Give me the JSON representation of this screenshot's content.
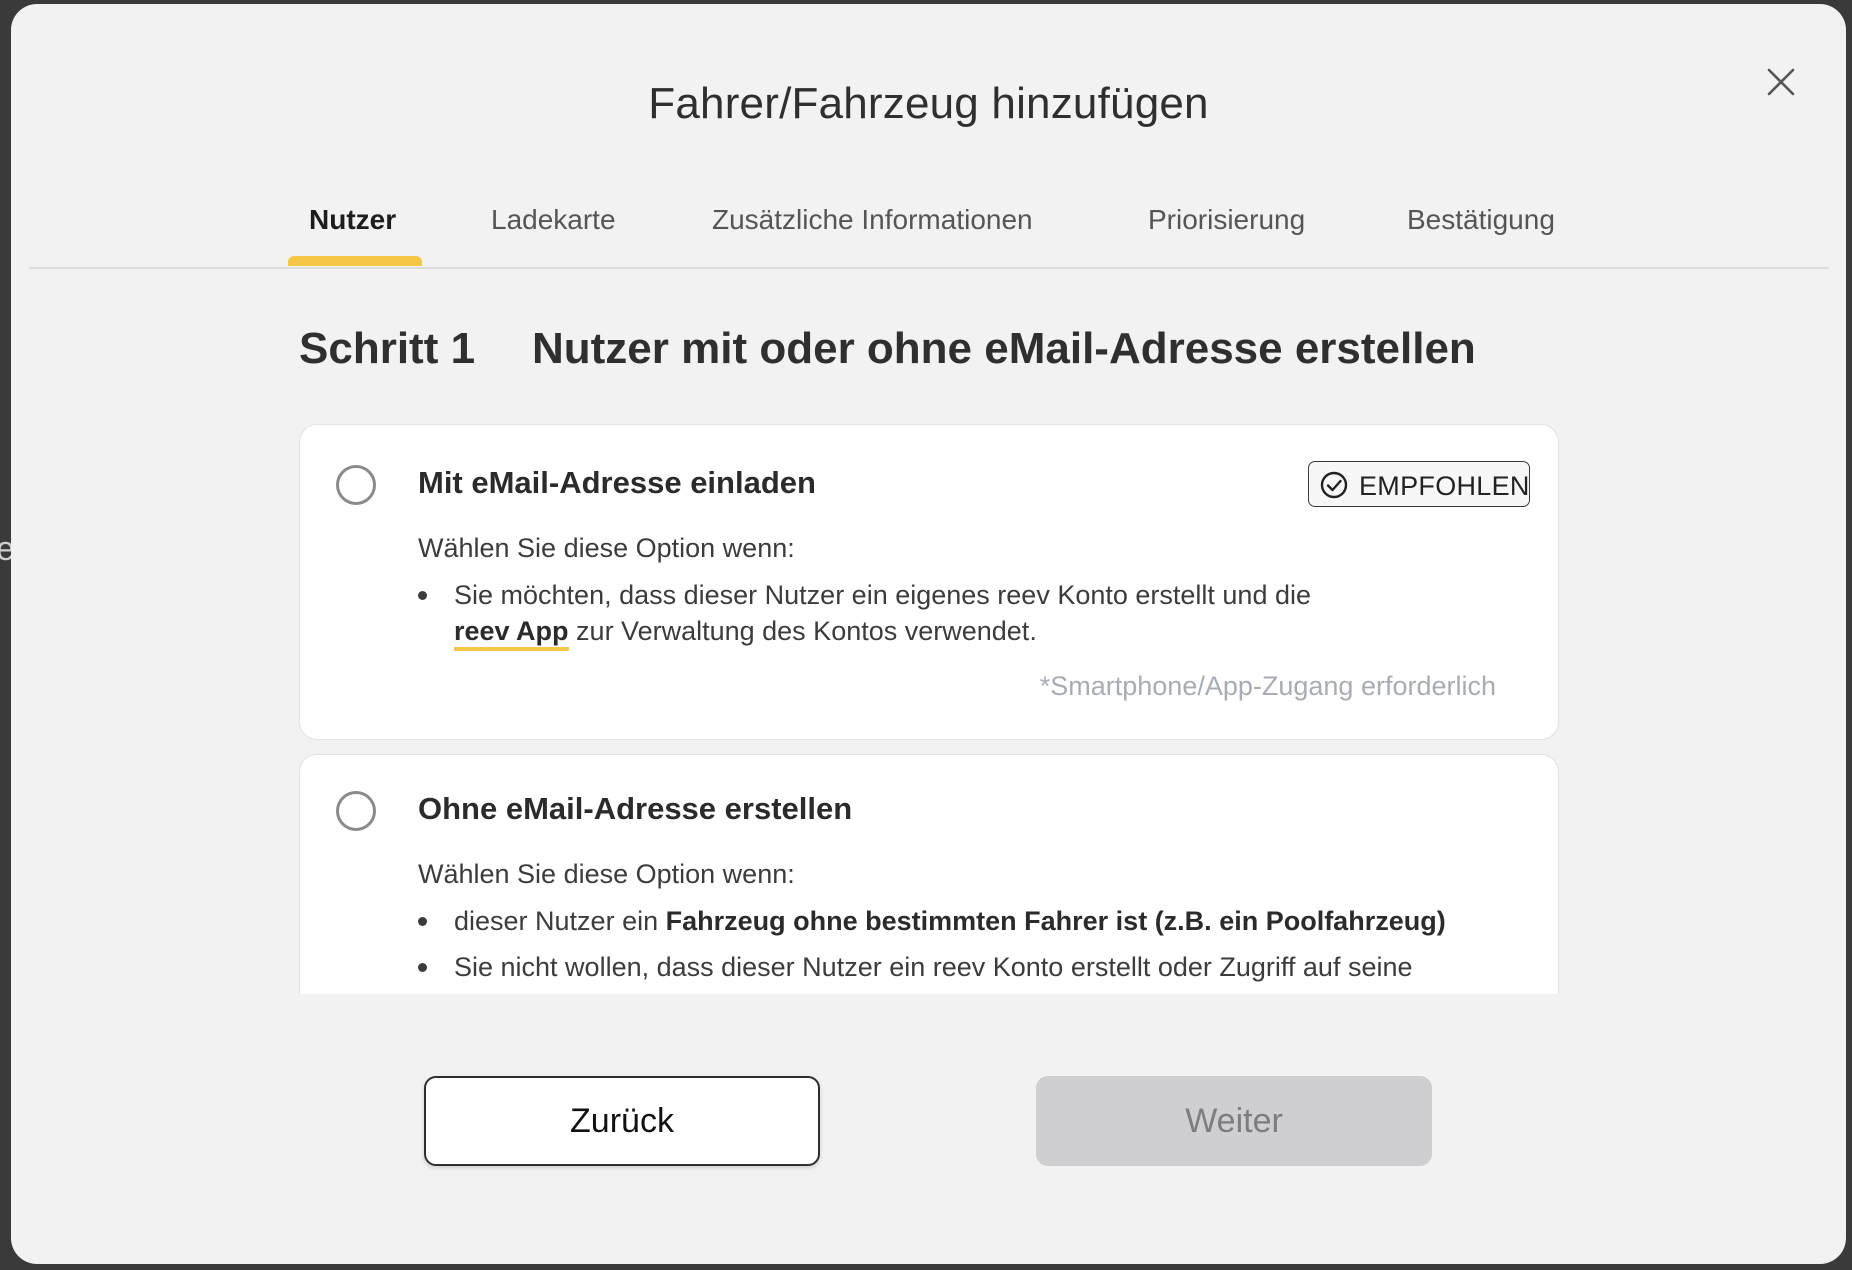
{
  "dialog": {
    "title": "Fahrer/Fahrzeug hinzufügen",
    "background_fragment": "e"
  },
  "tabs": [
    {
      "label": "Nutzer",
      "active": true
    },
    {
      "label": "Ladekarte",
      "active": false
    },
    {
      "label": "Zusätzliche Informationen",
      "active": false
    },
    {
      "label": "Priorisierung",
      "active": false
    },
    {
      "label": "Bestätigung",
      "active": false
    }
  ],
  "step": {
    "number_label": "Schritt 1",
    "title": "Nutzer mit oder ohne eMail-Adresse erstellen"
  },
  "options": [
    {
      "title": "Mit eMail-Adresse einladen",
      "badge": "EMPFOHLEN",
      "intro": "Wählen Sie diese Option wenn:",
      "bullet1_line1": "Sie möchten, dass dieser Nutzer ein eigenes reev Konto erstellt und die",
      "bullet1_link": "reev App",
      "bullet1_line2_rest": " zur Verwaltung des Kontos verwendet.",
      "note": "*Smartphone/App-Zugang erforderlich",
      "selected": false
    },
    {
      "title": "Ohne eMail-Adresse erstellen",
      "intro": "Wählen Sie diese Option wenn:",
      "bullet1_prefix": "dieser Nutzer ein ",
      "bullet1_bold": "Fahrzeug ohne bestimmten Fahrer ist (z.B. ein Poolfahrzeug)",
      "bullet2": "Sie nicht wollen, dass dieser Nutzer ein reev Konto erstellt oder Zugriff auf seine",
      "selected": false
    }
  ],
  "footer": {
    "back_label": "Zurück",
    "next_label": "Weiter",
    "next_enabled": false
  },
  "colors": {
    "accent": "#f6c744",
    "modal_bg": "#f2f2f2",
    "disabled_button": "#cfcfd1",
    "note_text": "#a8acb4"
  },
  "icons": {
    "close": "close-icon",
    "badge": "check-circle-icon"
  }
}
